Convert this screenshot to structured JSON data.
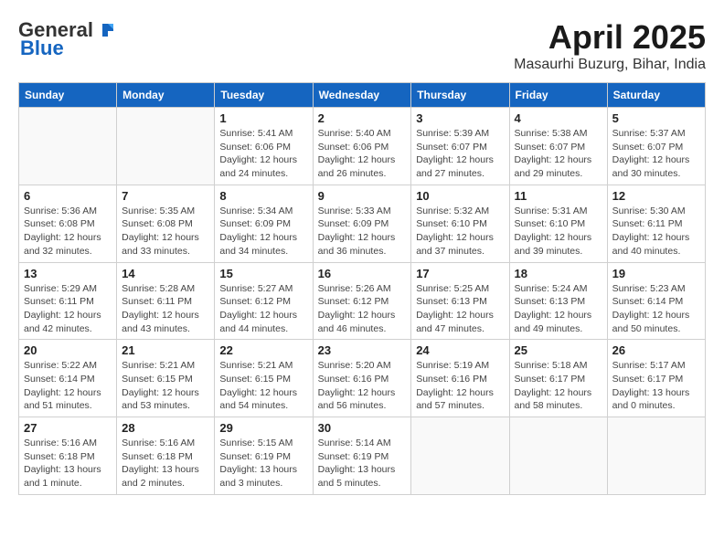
{
  "logo": {
    "general": "General",
    "blue": "Blue"
  },
  "title": "April 2025",
  "subtitle": "Masaurhi Buzurg, Bihar, India",
  "weekdays": [
    "Sunday",
    "Monday",
    "Tuesday",
    "Wednesday",
    "Thursday",
    "Friday",
    "Saturday"
  ],
  "weeks": [
    [
      {
        "day": "",
        "empty": true
      },
      {
        "day": "",
        "empty": true
      },
      {
        "day": "1",
        "sunrise": "Sunrise: 5:41 AM",
        "sunset": "Sunset: 6:06 PM",
        "daylight": "Daylight: 12 hours and 24 minutes."
      },
      {
        "day": "2",
        "sunrise": "Sunrise: 5:40 AM",
        "sunset": "Sunset: 6:06 PM",
        "daylight": "Daylight: 12 hours and 26 minutes."
      },
      {
        "day": "3",
        "sunrise": "Sunrise: 5:39 AM",
        "sunset": "Sunset: 6:07 PM",
        "daylight": "Daylight: 12 hours and 27 minutes."
      },
      {
        "day": "4",
        "sunrise": "Sunrise: 5:38 AM",
        "sunset": "Sunset: 6:07 PM",
        "daylight": "Daylight: 12 hours and 29 minutes."
      },
      {
        "day": "5",
        "sunrise": "Sunrise: 5:37 AM",
        "sunset": "Sunset: 6:07 PM",
        "daylight": "Daylight: 12 hours and 30 minutes."
      }
    ],
    [
      {
        "day": "6",
        "sunrise": "Sunrise: 5:36 AM",
        "sunset": "Sunset: 6:08 PM",
        "daylight": "Daylight: 12 hours and 32 minutes."
      },
      {
        "day": "7",
        "sunrise": "Sunrise: 5:35 AM",
        "sunset": "Sunset: 6:08 PM",
        "daylight": "Daylight: 12 hours and 33 minutes."
      },
      {
        "day": "8",
        "sunrise": "Sunrise: 5:34 AM",
        "sunset": "Sunset: 6:09 PM",
        "daylight": "Daylight: 12 hours and 34 minutes."
      },
      {
        "day": "9",
        "sunrise": "Sunrise: 5:33 AM",
        "sunset": "Sunset: 6:09 PM",
        "daylight": "Daylight: 12 hours and 36 minutes."
      },
      {
        "day": "10",
        "sunrise": "Sunrise: 5:32 AM",
        "sunset": "Sunset: 6:10 PM",
        "daylight": "Daylight: 12 hours and 37 minutes."
      },
      {
        "day": "11",
        "sunrise": "Sunrise: 5:31 AM",
        "sunset": "Sunset: 6:10 PM",
        "daylight": "Daylight: 12 hours and 39 minutes."
      },
      {
        "day": "12",
        "sunrise": "Sunrise: 5:30 AM",
        "sunset": "Sunset: 6:11 PM",
        "daylight": "Daylight: 12 hours and 40 minutes."
      }
    ],
    [
      {
        "day": "13",
        "sunrise": "Sunrise: 5:29 AM",
        "sunset": "Sunset: 6:11 PM",
        "daylight": "Daylight: 12 hours and 42 minutes."
      },
      {
        "day": "14",
        "sunrise": "Sunrise: 5:28 AM",
        "sunset": "Sunset: 6:11 PM",
        "daylight": "Daylight: 12 hours and 43 minutes."
      },
      {
        "day": "15",
        "sunrise": "Sunrise: 5:27 AM",
        "sunset": "Sunset: 6:12 PM",
        "daylight": "Daylight: 12 hours and 44 minutes."
      },
      {
        "day": "16",
        "sunrise": "Sunrise: 5:26 AM",
        "sunset": "Sunset: 6:12 PM",
        "daylight": "Daylight: 12 hours and 46 minutes."
      },
      {
        "day": "17",
        "sunrise": "Sunrise: 5:25 AM",
        "sunset": "Sunset: 6:13 PM",
        "daylight": "Daylight: 12 hours and 47 minutes."
      },
      {
        "day": "18",
        "sunrise": "Sunrise: 5:24 AM",
        "sunset": "Sunset: 6:13 PM",
        "daylight": "Daylight: 12 hours and 49 minutes."
      },
      {
        "day": "19",
        "sunrise": "Sunrise: 5:23 AM",
        "sunset": "Sunset: 6:14 PM",
        "daylight": "Daylight: 12 hours and 50 minutes."
      }
    ],
    [
      {
        "day": "20",
        "sunrise": "Sunrise: 5:22 AM",
        "sunset": "Sunset: 6:14 PM",
        "daylight": "Daylight: 12 hours and 51 minutes."
      },
      {
        "day": "21",
        "sunrise": "Sunrise: 5:21 AM",
        "sunset": "Sunset: 6:15 PM",
        "daylight": "Daylight: 12 hours and 53 minutes."
      },
      {
        "day": "22",
        "sunrise": "Sunrise: 5:21 AM",
        "sunset": "Sunset: 6:15 PM",
        "daylight": "Daylight: 12 hours and 54 minutes."
      },
      {
        "day": "23",
        "sunrise": "Sunrise: 5:20 AM",
        "sunset": "Sunset: 6:16 PM",
        "daylight": "Daylight: 12 hours and 56 minutes."
      },
      {
        "day": "24",
        "sunrise": "Sunrise: 5:19 AM",
        "sunset": "Sunset: 6:16 PM",
        "daylight": "Daylight: 12 hours and 57 minutes."
      },
      {
        "day": "25",
        "sunrise": "Sunrise: 5:18 AM",
        "sunset": "Sunset: 6:17 PM",
        "daylight": "Daylight: 12 hours and 58 minutes."
      },
      {
        "day": "26",
        "sunrise": "Sunrise: 5:17 AM",
        "sunset": "Sunset: 6:17 PM",
        "daylight": "Daylight: 13 hours and 0 minutes."
      }
    ],
    [
      {
        "day": "27",
        "sunrise": "Sunrise: 5:16 AM",
        "sunset": "Sunset: 6:18 PM",
        "daylight": "Daylight: 13 hours and 1 minute."
      },
      {
        "day": "28",
        "sunrise": "Sunrise: 5:16 AM",
        "sunset": "Sunset: 6:18 PM",
        "daylight": "Daylight: 13 hours and 2 minutes."
      },
      {
        "day": "29",
        "sunrise": "Sunrise: 5:15 AM",
        "sunset": "Sunset: 6:19 PM",
        "daylight": "Daylight: 13 hours and 3 minutes."
      },
      {
        "day": "30",
        "sunrise": "Sunrise: 5:14 AM",
        "sunset": "Sunset: 6:19 PM",
        "daylight": "Daylight: 13 hours and 5 minutes."
      },
      {
        "day": "",
        "empty": true
      },
      {
        "day": "",
        "empty": true
      },
      {
        "day": "",
        "empty": true
      }
    ]
  ]
}
